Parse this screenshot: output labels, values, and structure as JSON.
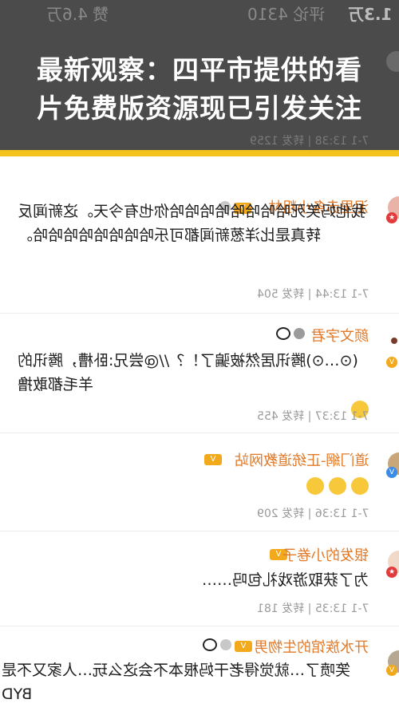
{
  "tabs": {
    "reposts": "赞 4.6万",
    "comments": "评论 4310",
    "likes": "1.3万"
  },
  "headline": {
    "line1": "最新观察：四平市提供的看",
    "line2": "片免费版资源现已引发关注"
  },
  "top_meta": "7-1 13:38 | 转发 1259",
  "comments": [
    {
      "name": "泥里赤条小粗林",
      "text": "我他妈笑死哈哈哈哈哈哈哈哈你也有今天。这新闻反转真是比洋葱新闻都可乐哈哈哈哈哈哈哈哈。",
      "meta": "7-1 13:44 | 转发 504"
    },
    {
      "name": "颜文字君",
      "text": "(⊙…⊙)腾讯居然被骗了！？//@尝兄:卧槽，腾讯的羊毛都敢撸",
      "meta": "7-1 13:37 | 转发 455"
    },
    {
      "name": "道门網-正统道教网站",
      "text": "",
      "meta": "7-1 13:36 | 转发 209"
    },
    {
      "name": "银发的小卷子",
      "text": "为了获取游戏礼包吗……",
      "meta": "7-1 13:35 | 转发 181"
    },
    {
      "name": "开水族馆的生物男",
      "text": "笑喷了…就觉得老干妈根本不会这么玩…人家又不是BYD",
      "meta": ""
    }
  ],
  "colors": {
    "overlay": "#4b4b4b",
    "stripe": "#f2c21d",
    "username": "#e07a2a",
    "meta": "#9a9a9a"
  }
}
